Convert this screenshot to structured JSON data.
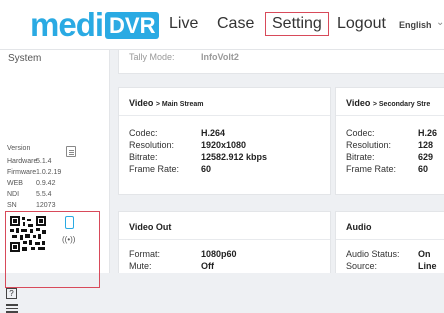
{
  "header": {
    "logo_text": "medi",
    "logo_badge": "DVR",
    "nav": {
      "live": "Live",
      "case": "Case",
      "setting": "Setting",
      "logout": "Logout"
    },
    "language": "English"
  },
  "sidebar": {
    "top_item": "System",
    "version_label": "Version",
    "info": [
      {
        "label": "Hardware",
        "value": "5.1.4"
      },
      {
        "label": "Firmware",
        "value": "1.0.2.19"
      },
      {
        "label": "WEB",
        "value": "0.9.42"
      },
      {
        "label": "NDI",
        "value": "5.5.4"
      },
      {
        "label": "SN",
        "value": "12073"
      }
    ]
  },
  "top_partial": {
    "label": "Tally Mode:",
    "value": "InfoVolt2"
  },
  "cards": {
    "main_stream": {
      "title": "Video",
      "title_suffix": "> Main Stream",
      "rows": [
        {
          "label": "Codec:",
          "value": "H.264"
        },
        {
          "label": "Resolution:",
          "value": "1920x1080"
        },
        {
          "label": "Bitrate:",
          "value": "12582.912 kbps"
        },
        {
          "label": "Frame Rate:",
          "value": "60"
        }
      ]
    },
    "secondary_stream": {
      "title": "Video",
      "title_suffix": "> Secondary Stre",
      "rows": [
        {
          "label": "Codec:",
          "value": "H.26"
        },
        {
          "label": "Resolution:",
          "value": "128"
        },
        {
          "label": "Bitrate:",
          "value": "629"
        },
        {
          "label": "Frame Rate:",
          "value": "60"
        }
      ]
    },
    "video_out": {
      "title": "Video Out",
      "rows": [
        {
          "label": "Format:",
          "value": "1080p60"
        },
        {
          "label": "Mute:",
          "value": "Off"
        }
      ]
    },
    "audio": {
      "title": "Audio",
      "rows": [
        {
          "label": "Audio Status:",
          "value": "On"
        },
        {
          "label": "Source:",
          "value": "Line"
        }
      ]
    }
  }
}
